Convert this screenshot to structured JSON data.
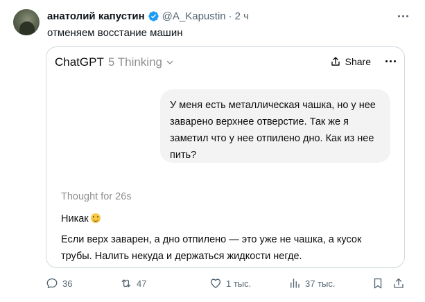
{
  "tweet": {
    "author_name": "анатолий капустин",
    "handle": "@A_Kapustin",
    "separator": "·",
    "time": "2 ч",
    "text": "отменяем восстание машин"
  },
  "card": {
    "brand": "ChatGPT",
    "model": "5 Thinking",
    "share_label": "Share",
    "user_message": "У меня есть металлическая чашка, но у нее заварено верхнее отверстие. Так же я заметил что у нее отпилено дно. Как из нее пить?",
    "thought_label": "Thought for 26s",
    "answer_line1": "Никак",
    "answer_line2": "Если верх заварен, а дно отпилено — это уже не чашка, а кусок трубы. Налить некуда и держаться жидкости негде."
  },
  "actions": {
    "replies": "36",
    "reposts": "47",
    "likes": "1 тыс.",
    "views": "37 тыс."
  },
  "colors": {
    "verified": "#1d9bf0",
    "muted": "#536471",
    "bubble": "#f3f3f3",
    "border": "#cfd9de"
  },
  "icons": [
    "verified-icon",
    "more-icon",
    "chevron-down-icon",
    "share-icon",
    "reply-icon",
    "repost-icon",
    "like-icon",
    "views-icon",
    "bookmark-icon",
    "upload-icon",
    "smile-emoji-icon"
  ]
}
